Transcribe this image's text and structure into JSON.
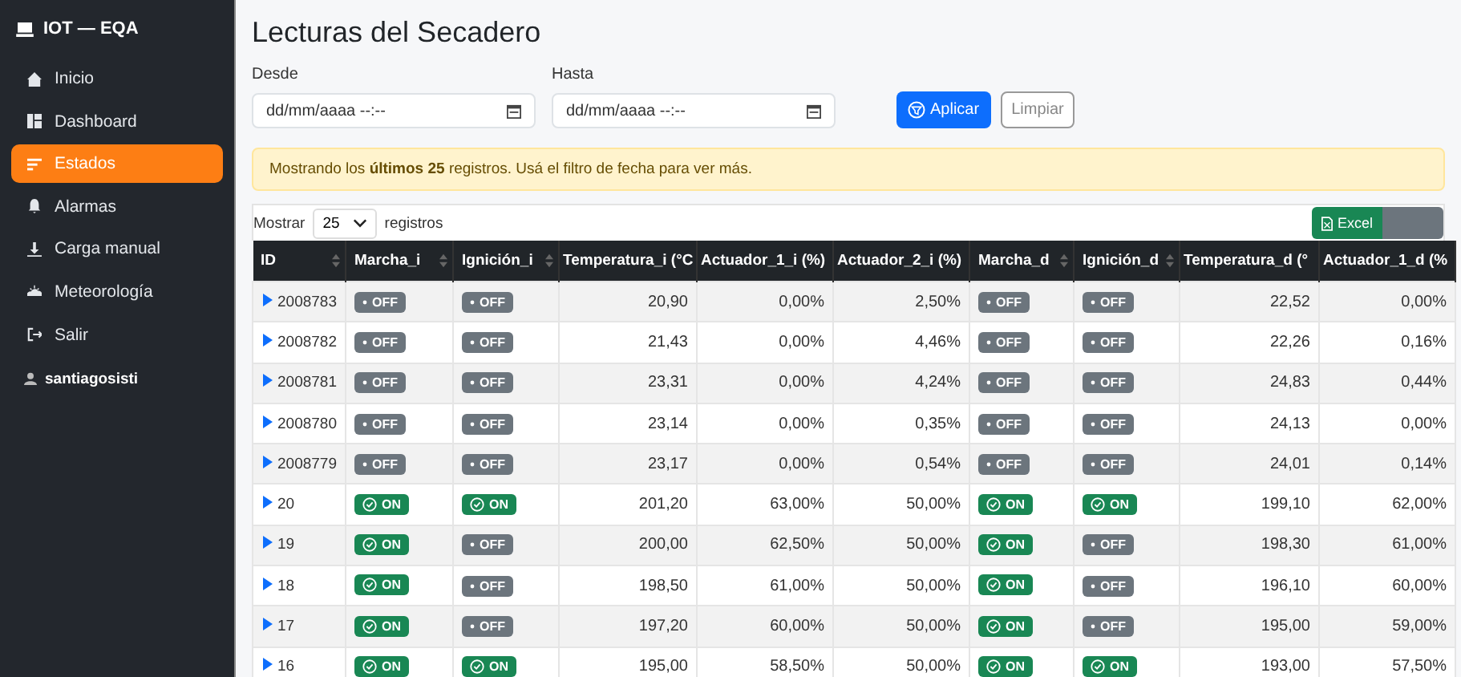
{
  "sidebar": {
    "brand": "IOT — EQA",
    "items": [
      {
        "label": "Inicio",
        "selected": false
      },
      {
        "label": "Dashboard",
        "selected": false
      },
      {
        "label": "Estados",
        "selected": true
      },
      {
        "label": "Alarmas",
        "selected": false
      },
      {
        "label": "Carga manual",
        "selected": false
      },
      {
        "label": "Meteorología",
        "selected": false
      },
      {
        "label": "Salir",
        "selected": false
      }
    ],
    "user": "santiagosisti"
  },
  "title": "Lecturas del Secadero",
  "filters": [
    {
      "label": "Desde",
      "placeholder": "dd/mm/aaaa --:--"
    },
    {
      "label": "Hasta",
      "placeholder": "dd/mm/aaaa --:--"
    }
  ],
  "apply_button": "Aplicar",
  "clear_button": "Limpiar",
  "alert": "Mostrando los **últimos 25** registros. Usá el filtro de fecha para ver más.",
  "length_menu": {
    "before": "Mostrar",
    "value": "25",
    "after": "registros"
  },
  "excel_button": "Excel",
  "table": {
    "columns": [
      {
        "label": "ID",
        "kind": "id",
        "sortable": true
      },
      {
        "label": "Marcha_i",
        "kind": "badge",
        "sortable": true
      },
      {
        "label": "Ignición_i",
        "kind": "badge",
        "sortable": true
      },
      {
        "label": "Temperatura_i (°C",
        "kind": "number",
        "sortable": false
      },
      {
        "label": "Actuador_1_i (%)",
        "kind": "number",
        "sortable": false
      },
      {
        "label": "Actuador_2_i (%)",
        "kind": "number",
        "sortable": false
      },
      {
        "label": "Marcha_d",
        "kind": "badge",
        "sortable": true
      },
      {
        "label": "Ignición_d",
        "kind": "badge",
        "sortable": true
      },
      {
        "label": "Temperatura_d (°",
        "kind": "number",
        "sortable": false
      },
      {
        "label": "Actuador_1_d (%",
        "kind": "number",
        "sortable": false
      }
    ],
    "rows": [
      [
        {
          "text": "2008783"
        },
        {
          "label": "OFF",
          "on": false
        },
        {
          "label": "OFF",
          "on": false
        },
        {
          "text": "20,90"
        },
        {
          "text": "0,00%"
        },
        {
          "text": "2,50%"
        },
        {
          "label": "OFF",
          "on": false
        },
        {
          "label": "OFF",
          "on": false
        },
        {
          "text": "22,52"
        },
        {
          "text": "0,00%"
        }
      ],
      [
        {
          "text": "2008782"
        },
        {
          "label": "OFF",
          "on": false
        },
        {
          "label": "OFF",
          "on": false
        },
        {
          "text": "21,43"
        },
        {
          "text": "0,00%"
        },
        {
          "text": "4,46%"
        },
        {
          "label": "OFF",
          "on": false
        },
        {
          "label": "OFF",
          "on": false
        },
        {
          "text": "22,26"
        },
        {
          "text": "0,16%"
        }
      ],
      [
        {
          "text": "2008781"
        },
        {
          "label": "OFF",
          "on": false
        },
        {
          "label": "OFF",
          "on": false
        },
        {
          "text": "23,31"
        },
        {
          "text": "0,00%"
        },
        {
          "text": "4,24%"
        },
        {
          "label": "OFF",
          "on": false
        },
        {
          "label": "OFF",
          "on": false
        },
        {
          "text": "24,83"
        },
        {
          "text": "0,44%"
        }
      ],
      [
        {
          "text": "2008780"
        },
        {
          "label": "OFF",
          "on": false
        },
        {
          "label": "OFF",
          "on": false
        },
        {
          "text": "23,14"
        },
        {
          "text": "0,00%"
        },
        {
          "text": "0,35%"
        },
        {
          "label": "OFF",
          "on": false
        },
        {
          "label": "OFF",
          "on": false
        },
        {
          "text": "24,13"
        },
        {
          "text": "0,00%"
        }
      ],
      [
        {
          "text": "2008779"
        },
        {
          "label": "OFF",
          "on": false
        },
        {
          "label": "OFF",
          "on": false
        },
        {
          "text": "23,17"
        },
        {
          "text": "0,00%"
        },
        {
          "text": "0,54%"
        },
        {
          "label": "OFF",
          "on": false
        },
        {
          "label": "OFF",
          "on": false
        },
        {
          "text": "24,01"
        },
        {
          "text": "0,14%"
        }
      ],
      [
        {
          "text": "20"
        },
        {
          "label": "ON",
          "on": true
        },
        {
          "label": "ON",
          "on": true
        },
        {
          "text": "201,20"
        },
        {
          "text": "63,00%"
        },
        {
          "text": "50,00%"
        },
        {
          "label": "ON",
          "on": true
        },
        {
          "label": "ON",
          "on": true
        },
        {
          "text": "199,10"
        },
        {
          "text": "62,00%"
        }
      ],
      [
        {
          "text": "19"
        },
        {
          "label": "ON",
          "on": true
        },
        {
          "label": "OFF",
          "on": false
        },
        {
          "text": "200,00"
        },
        {
          "text": "62,50%"
        },
        {
          "text": "50,00%"
        },
        {
          "label": "ON",
          "on": true
        },
        {
          "label": "OFF",
          "on": false
        },
        {
          "text": "198,30"
        },
        {
          "text": "61,00%"
        }
      ],
      [
        {
          "text": "18"
        },
        {
          "label": "ON",
          "on": true
        },
        {
          "label": "OFF",
          "on": false
        },
        {
          "text": "198,50"
        },
        {
          "text": "61,00%"
        },
        {
          "text": "50,00%"
        },
        {
          "label": "ON",
          "on": true
        },
        {
          "label": "OFF",
          "on": false
        },
        {
          "text": "196,10"
        },
        {
          "text": "60,00%"
        }
      ],
      [
        {
          "text": "17"
        },
        {
          "label": "ON",
          "on": true
        },
        {
          "label": "OFF",
          "on": false
        },
        {
          "text": "197,20"
        },
        {
          "text": "60,00%"
        },
        {
          "text": "50,00%"
        },
        {
          "label": "ON",
          "on": true
        },
        {
          "label": "OFF",
          "on": false
        },
        {
          "text": "195,00"
        },
        {
          "text": "59,00%"
        }
      ],
      [
        {
          "text": "16"
        },
        {
          "label": "ON",
          "on": true
        },
        {
          "label": "ON",
          "on": true
        },
        {
          "text": "195,00"
        },
        {
          "text": "58,50%"
        },
        {
          "text": "50,00%"
        },
        {
          "label": "ON",
          "on": true
        },
        {
          "label": "ON",
          "on": true
        },
        {
          "text": "193,00"
        },
        {
          "text": "57,50%"
        }
      ]
    ]
  }
}
